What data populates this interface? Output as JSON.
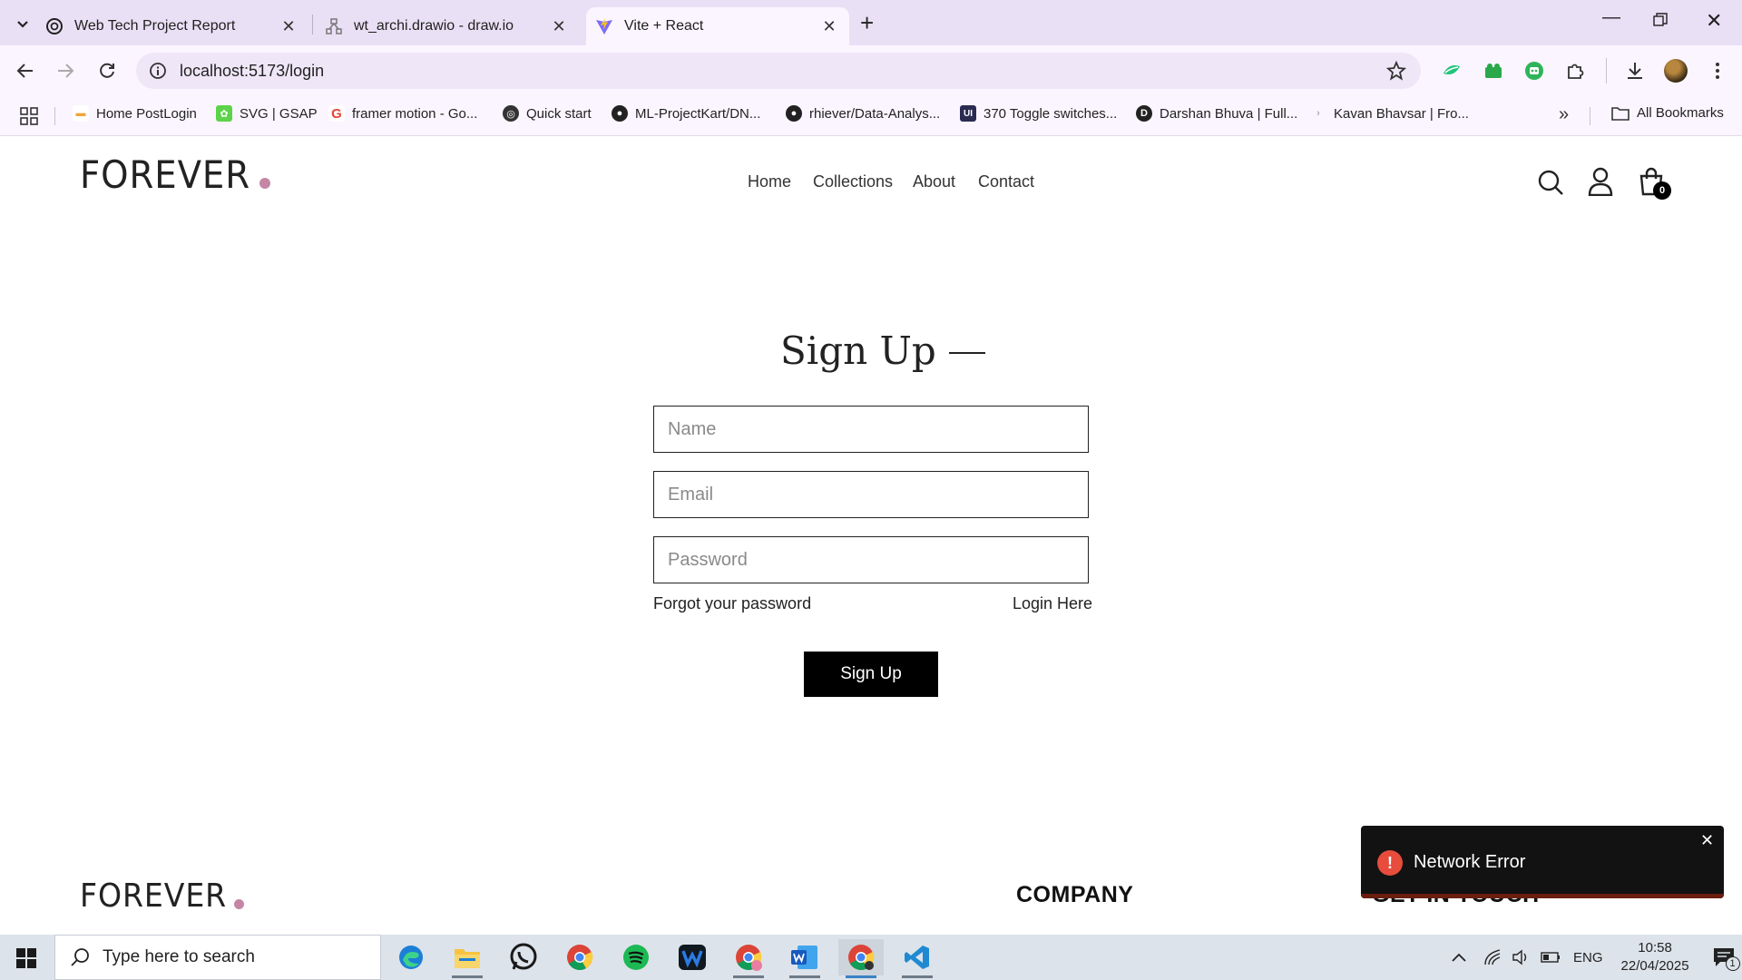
{
  "browser": {
    "tabs": [
      {
        "title": "Web Tech Project Report",
        "icon": "chatgpt-icon",
        "active": false
      },
      {
        "title": "wt_archi.drawio - draw.io",
        "icon": "drawio-icon",
        "active": false
      },
      {
        "title": "Vite + React",
        "icon": "vite-icon",
        "active": true
      }
    ],
    "url": "localhost:5173/login",
    "bookmarks": [
      {
        "label": "Home PostLogin",
        "icon": "postlogin-icon",
        "color": "#f2a33a"
      },
      {
        "label": "SVG | GSAP",
        "icon": "gsap-icon",
        "color": "#5dd34a"
      },
      {
        "label": "framer motion - Go...",
        "icon": "google-icon",
        "color": "#4285f4"
      },
      {
        "label": "Quick start",
        "icon": "globe-icon",
        "color": "#333333"
      },
      {
        "label": "ML-ProjectKart/DN...",
        "icon": "github-icon",
        "color": "#222222"
      },
      {
        "label": "rhiever/Data-Analys...",
        "icon": "github-icon",
        "color": "#222222"
      },
      {
        "label": "370 Toggle switches...",
        "icon": "uiverse-icon",
        "color": "#2b2b52"
      },
      {
        "label": "Darshan Bhuva | Full...",
        "icon": "darshan-icon",
        "color": "#222222"
      },
      {
        "label": "Kavan Bhavsar | Fro...",
        "icon": "kavan-icon",
        "color": "#aaaaaa"
      }
    ],
    "all_bookmarks": "All Bookmarks"
  },
  "site": {
    "logo": "FOREVER",
    "nav": [
      "Home",
      "Collections",
      "About",
      "Contact"
    ],
    "cart_count": "0",
    "accent": "#c586a5"
  },
  "form": {
    "heading": "Sign Up",
    "name_placeholder": "Name",
    "email_placeholder": "Email",
    "password_placeholder": "Password",
    "forgot": "Forgot your password",
    "login_link": "Login Here",
    "submit": "Sign Up"
  },
  "footer": {
    "logo": "FOREVER",
    "company": "COMPANY",
    "get_in_touch": "GET IN TOUCH"
  },
  "toast": {
    "message": "Network Error",
    "color": "#e74c3c"
  },
  "taskbar": {
    "search_placeholder": "Type here to search",
    "apps": [
      "edge-icon",
      "file-explorer-icon",
      "whatsapp-icon",
      "chrome-icon",
      "spotify-icon",
      "webex-icon",
      "chrome-profile-icon",
      "word-icon",
      "chrome-active-icon",
      "vscode-icon"
    ],
    "language": "ENG",
    "time": "10:58",
    "date": "22/04/2025",
    "notification_count": "1"
  }
}
